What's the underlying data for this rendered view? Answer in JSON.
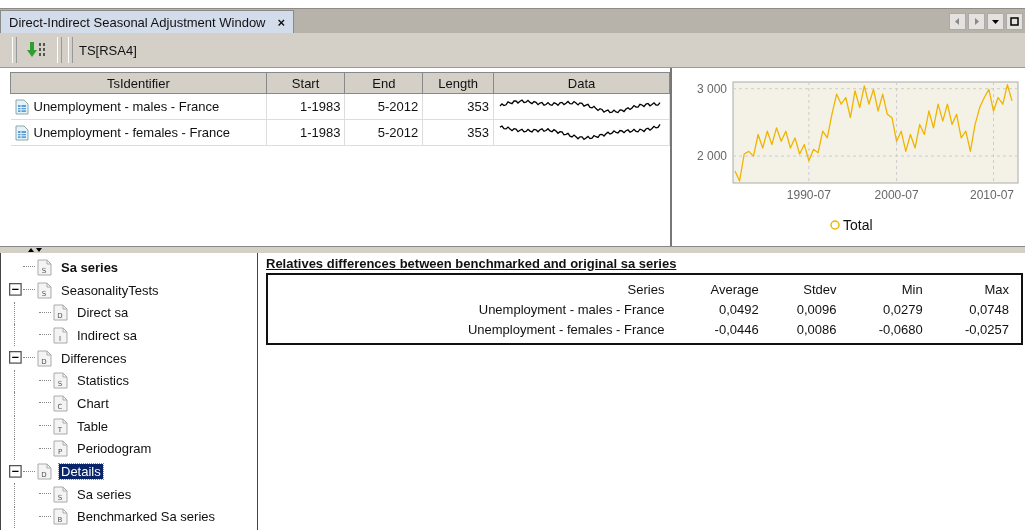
{
  "window": {
    "tab": {
      "title": "Direct-Indirect Seasonal Adjustment Window",
      "close": "×",
      "selected": true
    }
  },
  "toolbar": {
    "label": "TS[RSA4]"
  },
  "series_table": {
    "columns": [
      "TsIdentifier",
      "Start",
      "End",
      "Length",
      "Data"
    ],
    "rows": [
      {
        "name": "Unemployment - males - France",
        "start": "1-1983",
        "end": "5-2012",
        "length": "353"
      },
      {
        "name": "Unemployment - females - France",
        "start": "1-1983",
        "end": "5-2012",
        "length": "353"
      }
    ]
  },
  "chart": {
    "chart_data": {
      "type": "line",
      "grid": true,
      "ylim": [
        1600,
        3100
      ],
      "yticks": [
        {
          "value": 2000,
          "label": "2 000"
        },
        {
          "value": 3000,
          "label": "3 000"
        }
      ],
      "categories": [
        null,
        null,
        null,
        null,
        null,
        null,
        null,
        null,
        null,
        null,
        null,
        null,
        null,
        null,
        null,
        null,
        "1990-07",
        null,
        null,
        null,
        null,
        null,
        null,
        null,
        null,
        null,
        null,
        null,
        null,
        null,
        null,
        null,
        null,
        null,
        null,
        "2000-07",
        null,
        null,
        null,
        null,
        null,
        null,
        null,
        null,
        null,
        null,
        null,
        null,
        null,
        null,
        null,
        null,
        null,
        null,
        null,
        null,
        "2010-07",
        null,
        null,
        null,
        null
      ],
      "series": [
        {
          "name": "Total",
          "color": "#f0b400",
          "values": [
            1780,
            1630,
            2030,
            2070,
            2000,
            2320,
            2120,
            2370,
            2170,
            2420,
            2220,
            2370,
            2120,
            2270,
            2030,
            2170,
            1930,
            2100,
            2050,
            2370,
            2270,
            2620,
            2920,
            2770,
            2870,
            2570,
            2970,
            2720,
            3040,
            2770,
            2990,
            2670,
            2920,
            2620,
            2570,
            2220,
            2370,
            2070,
            2320,
            2120,
            2470,
            2320,
            2670,
            2420,
            2770,
            2520,
            2770,
            2470,
            2620,
            2270,
            2370,
            2070,
            2470,
            2720,
            2870,
            2990,
            2670,
            2870,
            2770,
            3060,
            2820
          ]
        }
      ]
    }
  },
  "tree": {
    "items": [
      {
        "label": "Sa series",
        "icon_letter": "S",
        "kind": "root",
        "selected": false
      },
      {
        "label": "SeasonalityTests",
        "icon_letter": "S",
        "kind": "item",
        "selected": false,
        "expanded": true,
        "children": [
          {
            "label": "Direct sa",
            "icon_letter": "D",
            "kind": "item",
            "selected": false
          },
          {
            "label": "Indirect sa",
            "icon_letter": "I",
            "kind": "item",
            "selected": false
          }
        ]
      },
      {
        "label": "Differences",
        "icon_letter": "D",
        "kind": "item",
        "selected": false,
        "expanded": true,
        "children": [
          {
            "label": "Statistics",
            "icon_letter": "S",
            "kind": "item",
            "selected": false
          },
          {
            "label": "Chart",
            "icon_letter": "C",
            "kind": "item",
            "selected": false
          },
          {
            "label": "Table",
            "icon_letter": "T",
            "kind": "item",
            "selected": false
          },
          {
            "label": "Periodogram",
            "icon_letter": "P",
            "kind": "item",
            "selected": false
          }
        ]
      },
      {
        "label": "Details",
        "icon_letter": "D",
        "kind": "item",
        "selected": true,
        "expanded": true,
        "children": [
          {
            "label": "Sa series",
            "icon_letter": "S",
            "kind": "item",
            "selected": false
          },
          {
            "label": "Benchmarked Sa series",
            "icon_letter": "B",
            "kind": "item",
            "selected": false
          }
        ]
      }
    ]
  },
  "details": {
    "title": "Relatives differences between benchmarked and original sa series",
    "columns": [
      "Series",
      "Average",
      "Stdev",
      "Min",
      "Max"
    ],
    "rows": [
      [
        "Unemployment - males - France",
        "0,0492",
        "0,0096",
        "0,0279",
        "0,0748"
      ],
      [
        "Unemployment - females - France",
        "-0,0446",
        "0,0086",
        "-0,0680",
        "-0,0257"
      ]
    ]
  }
}
